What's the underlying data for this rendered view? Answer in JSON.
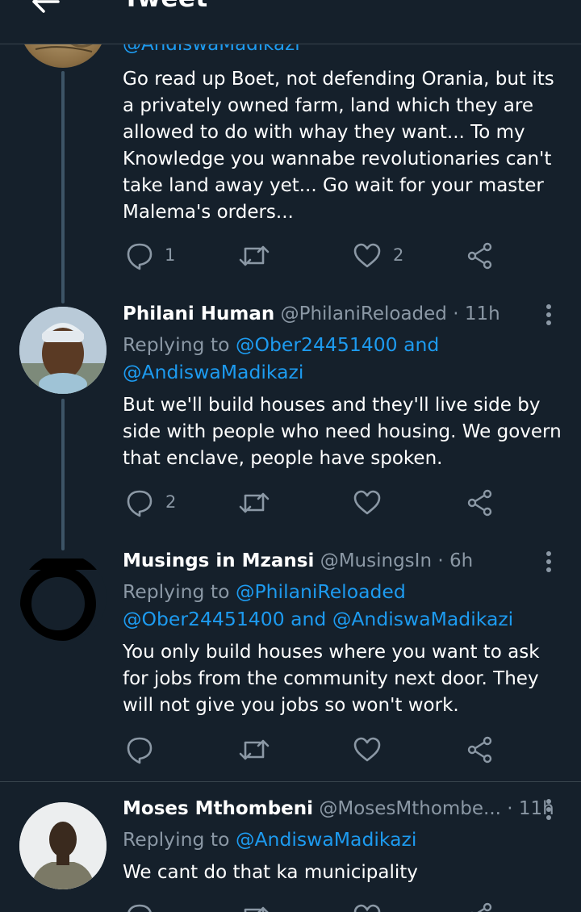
{
  "header": {
    "title": "Tweet"
  },
  "tweets": [
    {
      "handle": "@AndiswaMadikazi",
      "text": "Go read up Boet, not defending Orania, but its a privately owned farm, land which they are allowed to do with whay they want... To my Knowledge you wannabe revolutionaries can't take land away yet... Go wait for your master Malema's orders...",
      "reply_count": "1",
      "retweet_count": "",
      "like_count": "2"
    },
    {
      "name": "Philani Human",
      "handle": "@PhilaniReloaded",
      "time": "· 11h",
      "replying_prefix": "Replying to",
      "replying_to": [
        "@Ober24451400",
        "and",
        "@AndiswaMadikazi"
      ],
      "text": "But we'll build houses and they'll live side by side with people who need housing. We govern that enclave, people have spoken.",
      "reply_count": "2",
      "like_count": ""
    },
    {
      "name": "Musings in Mzansi",
      "handle": "@MusingsIn",
      "time": "· 6h",
      "replying_prefix": "Replying to",
      "replying_to": [
        "@PhilaniReloaded",
        "@Ober24451400",
        "and",
        "@AndiswaMadikazi"
      ],
      "text": "You only build houses where you want to ask for jobs from the community next door. They will not give you jobs so won't work.",
      "reply_count": "",
      "like_count": ""
    },
    {
      "name": "Moses Mthombeni",
      "handle": "@MosesMthombe...",
      "time": "· 11h",
      "replying_prefix": "Replying to",
      "replying_to": [
        "@AndiswaMadikazi"
      ],
      "text": "We cant do that ka municipality"
    }
  ],
  "colors": {
    "background": "#15202b",
    "accent": "#1d9bf0",
    "muted": "#8b98a5",
    "divider": "#38444d"
  },
  "icons": [
    "back-arrow-icon",
    "reply-icon",
    "retweet-icon",
    "like-icon",
    "share-icon",
    "more-icon"
  ]
}
